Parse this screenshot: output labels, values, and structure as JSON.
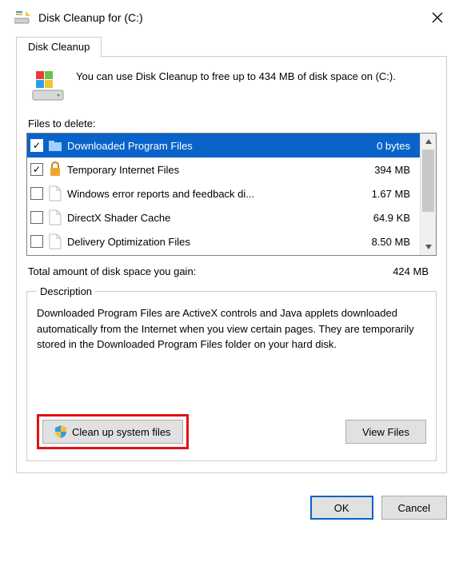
{
  "window": {
    "title": "Disk Cleanup for  (C:)",
    "close_label": "Close"
  },
  "tab": {
    "label": "Disk Cleanup"
  },
  "intro": "You can use Disk Cleanup to free up to 434 MB of disk space on  (C:).",
  "files_label": "Files to delete:",
  "files": [
    {
      "checked": true,
      "icon": "folder",
      "name": "Downloaded Program Files",
      "size": "0 bytes",
      "selected": true
    },
    {
      "checked": true,
      "icon": "lock",
      "name": "Temporary Internet Files",
      "size": "394 MB",
      "selected": false
    },
    {
      "checked": false,
      "icon": "file",
      "name": "Windows error reports and feedback di...",
      "size": "1.67 MB",
      "selected": false
    },
    {
      "checked": false,
      "icon": "file",
      "name": "DirectX Shader Cache",
      "size": "64.9 KB",
      "selected": false
    },
    {
      "checked": false,
      "icon": "file",
      "name": "Delivery Optimization Files",
      "size": "8.50 MB",
      "selected": false
    }
  ],
  "total": {
    "label": "Total amount of disk space you gain:",
    "value": "424 MB"
  },
  "description": {
    "legend": "Description",
    "text": "Downloaded Program Files are ActiveX controls and Java applets downloaded automatically from the Internet when you view certain pages. They are temporarily stored in the Downloaded Program Files folder on your hard disk."
  },
  "buttons": {
    "cleanup": "Clean up system files",
    "viewfiles": "View Files",
    "ok": "OK",
    "cancel": "Cancel"
  }
}
